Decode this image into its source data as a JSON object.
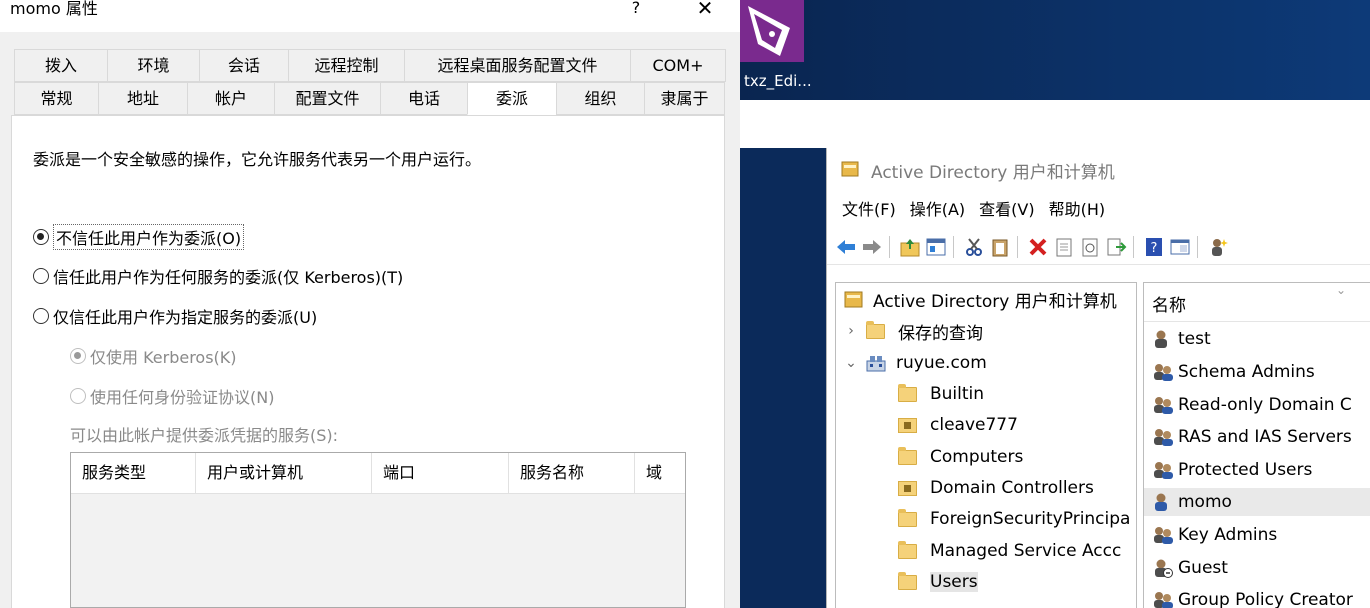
{
  "dialog": {
    "title": "momo 属性",
    "help": "?",
    "close": "✕",
    "tabs_row1": [
      "拨入",
      "环境",
      "会话",
      "远程控制",
      "远程桌面服务配置文件",
      "COM+"
    ],
    "tabs_row2": [
      "常规",
      "地址",
      "帐户",
      "配置文件",
      "电话",
      "委派",
      "组织",
      "隶属于"
    ],
    "active_tab": "委派",
    "description": "委派是一个安全敏感的操作，它允许服务代表另一个用户运行。",
    "options": [
      {
        "label": "不信任此用户作为委派(O)",
        "checked": true
      },
      {
        "label": "信任此用户作为任何服务的委派(仅 Kerberos)(T)",
        "checked": false
      },
      {
        "label": "仅信任此用户作为指定服务的委派(U)",
        "checked": false
      }
    ],
    "sub_options": [
      {
        "label": "仅使用 Kerberos(K)",
        "checked": true
      },
      {
        "label": "使用任何身份验证协议(N)",
        "checked": false
      }
    ],
    "services_label": "可以由此帐户提供委派凭据的服务(S):",
    "grid_columns": [
      "服务类型",
      "用户或计算机",
      "端口",
      "服务名称",
      "域"
    ]
  },
  "desktop": {
    "icon_label": "txz_Edi..."
  },
  "aduc": {
    "title": "Active Directory 用户和计算机",
    "menu": [
      "文件(F)",
      "操作(A)",
      "查看(V)",
      "帮助(H)"
    ],
    "tree": [
      {
        "label": "Active Directory 用户和计算机",
        "type": "root",
        "level": 0
      },
      {
        "label": "保存的查询",
        "type": "folder",
        "level": 1,
        "caret": "›"
      },
      {
        "label": "ruyue.com",
        "type": "domain",
        "level": 1,
        "caret": "⌄"
      },
      {
        "label": "Builtin",
        "type": "folder",
        "level": 2
      },
      {
        "label": "cleave777",
        "type": "ou",
        "level": 2
      },
      {
        "label": "Computers",
        "type": "folder",
        "level": 2
      },
      {
        "label": "Domain Controllers",
        "type": "ou",
        "level": 2
      },
      {
        "label": "ForeignSecurityPrincipa",
        "type": "folder",
        "level": 2
      },
      {
        "label": "Managed Service Accc",
        "type": "folder",
        "level": 2
      },
      {
        "label": "Users",
        "type": "folder",
        "level": 2,
        "selected": true
      }
    ],
    "list_header": "名称",
    "list": [
      {
        "label": "test",
        "type": "user"
      },
      {
        "label": "Schema Admins",
        "type": "group"
      },
      {
        "label": "Read-only Domain C",
        "type": "group"
      },
      {
        "label": "RAS and IAS Servers",
        "type": "group"
      },
      {
        "label": "Protected Users",
        "type": "group"
      },
      {
        "label": "momo",
        "type": "user",
        "selected": true
      },
      {
        "label": "Key Admins",
        "type": "group"
      },
      {
        "label": "Guest",
        "type": "guest"
      },
      {
        "label": "Group Policy Creator",
        "type": "group"
      }
    ]
  }
}
